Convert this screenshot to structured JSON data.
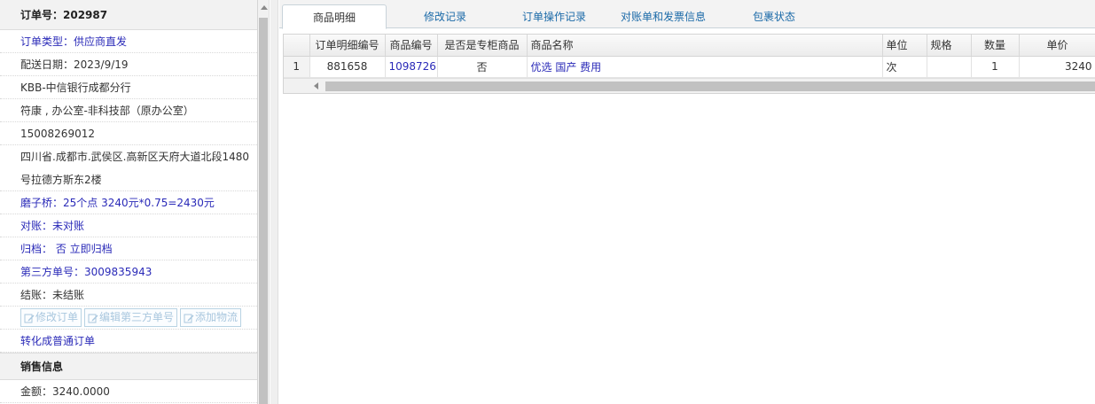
{
  "order_panel": {
    "header": "订单号：202987",
    "rows": [
      {
        "text": "订单类型：供应商直发",
        "blue": true
      },
      {
        "text": "配送日期：2023/9/19",
        "blue": false
      },
      {
        "text": "KBB-中信银行成都分行",
        "blue": false
      },
      {
        "text": "符康 , 办公室-非科技部（原办公室）",
        "blue": false
      },
      {
        "text": "15008269012",
        "blue": false
      },
      {
        "text": "四川省.成都市.武侯区.高新区天府大道北段1480",
        "blue": false,
        "noline": true
      },
      {
        "text": "号拉德方斯东2楼",
        "blue": false
      },
      {
        "text": "磨子桥：25个点 3240元*0.75=2430元",
        "blue": true
      },
      {
        "text": "对账：未对账",
        "blue": true
      },
      {
        "text": "归档： 否 立即归档",
        "blue": true
      },
      {
        "text": "第三方单号：3009835943",
        "blue": true
      },
      {
        "text": "结账：未结账",
        "blue": false
      }
    ],
    "buttons": {
      "edit_order": "修改订单",
      "edit_third_party": "编辑第三方单号",
      "add_logistics": "添加物流"
    },
    "convert_link": "转化成普通订单",
    "sales_section": "销售信息",
    "amount": "金额：3240.0000"
  },
  "tabs": [
    {
      "label": "商品明细",
      "active": true
    },
    {
      "label": "修改记录",
      "active": false
    },
    {
      "label": "订单操作记录",
      "active": false
    },
    {
      "label": "对账单和发票信息",
      "active": false
    },
    {
      "label": "包裹状态",
      "active": false
    }
  ],
  "table": {
    "headers": [
      "",
      "订单明细编号",
      "商品编号",
      "是否是专柜商品",
      "商品名称",
      "单位",
      "规格",
      "数量",
      "单价"
    ],
    "rows": [
      {
        "row_num": "1",
        "detail_id": "881658",
        "product_id": "1098726",
        "is_counter": "否",
        "product_name": "优选 国产 费用",
        "unit": "次",
        "spec": "",
        "qty": "1",
        "price": "3240"
      }
    ]
  },
  "colors": {
    "link_blue": "#2a2ab8",
    "tab_blue": "#1b6aa8",
    "button_disabled": "#a9c7de"
  }
}
